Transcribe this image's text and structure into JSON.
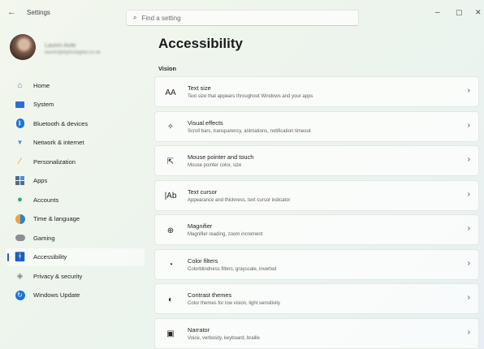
{
  "window": {
    "title": "Settings",
    "back_glyph": "←",
    "minimize_glyph": "–",
    "maximize_glyph": "▢",
    "close_glyph": "✕"
  },
  "search": {
    "placeholder": "Find a setting",
    "icon": "search-icon"
  },
  "profile": {
    "name": "Lauren Avile",
    "email": "lauren@bytesdigital.co.uk"
  },
  "sidebar": {
    "items": [
      {
        "label": "Home",
        "icon": "home-icon",
        "active": false
      },
      {
        "label": "System",
        "icon": "system-icon",
        "active": false
      },
      {
        "label": "Bluetooth & devices",
        "icon": "bluetooth-icon",
        "active": false
      },
      {
        "label": "Network & internet",
        "icon": "network-icon",
        "active": false
      },
      {
        "label": "Personalization",
        "icon": "brush-icon",
        "active": false
      },
      {
        "label": "Apps",
        "icon": "apps-icon",
        "active": false
      },
      {
        "label": "Accounts",
        "icon": "accounts-icon",
        "active": false
      },
      {
        "label": "Time & language",
        "icon": "globe-icon",
        "active": false
      },
      {
        "label": "Gaming",
        "icon": "gamepad-icon",
        "active": false
      },
      {
        "label": "Accessibility",
        "icon": "accessibility-icon",
        "active": true
      },
      {
        "label": "Privacy & security",
        "icon": "shield-icon",
        "active": false
      },
      {
        "label": "Windows Update",
        "icon": "update-icon",
        "active": false
      }
    ]
  },
  "main": {
    "title": "Accessibility",
    "section": "Vision",
    "cards": [
      {
        "icon": "text-size-icon",
        "icon_glyph": "AA",
        "title": "Text size",
        "subtitle": "Text size that appears throughout Windows and your apps"
      },
      {
        "icon": "visual-effects-icon",
        "icon_glyph": "✧",
        "title": "Visual effects",
        "subtitle": "Scroll bars, transparency, animations, notification timeout"
      },
      {
        "icon": "mouse-pointer-icon",
        "icon_glyph": "⇱",
        "title": "Mouse pointer and touch",
        "subtitle": "Mouse pointer color, size"
      },
      {
        "icon": "text-cursor-icon",
        "icon_glyph": "|Ab",
        "title": "Text cursor",
        "subtitle": "Appearance and thickness, text cursor indicator"
      },
      {
        "icon": "magnifier-icon",
        "icon_glyph": "⊕",
        "title": "Magnifier",
        "subtitle": "Magnifier reading, zoom increment"
      },
      {
        "icon": "color-filters-icon",
        "icon_glyph": "◔",
        "title": "Color filters",
        "subtitle": "Colorblindness filters, grayscale, inverted"
      },
      {
        "icon": "contrast-themes-icon",
        "icon_glyph": "◐",
        "title": "Contrast themes",
        "subtitle": "Color themes for low vision, light sensitivity"
      },
      {
        "icon": "narrator-icon",
        "icon_glyph": "▣",
        "title": "Narrator",
        "subtitle": "Voice, verbosity, keyboard, braille"
      }
    ]
  },
  "colors": {
    "accent": "#1f5fbf",
    "background": "#eef5ec"
  }
}
